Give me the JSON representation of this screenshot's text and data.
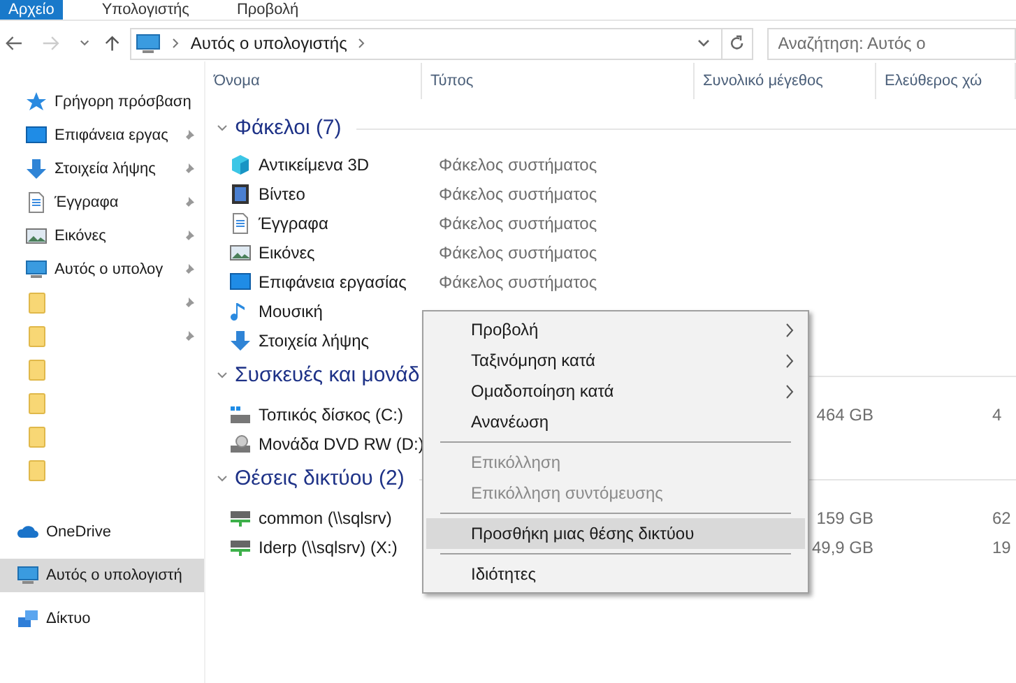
{
  "ribbon_tabs": [
    {
      "label": "Αρχείο",
      "selected": true
    },
    {
      "label": "Υπολογιστής",
      "selected": false
    },
    {
      "label": "Προβολή",
      "selected": false
    }
  ],
  "address_bar": {
    "path": "Αυτός ο υπολογιστής"
  },
  "search": {
    "placeholder": "Αναζήτηση: Αυτός ο"
  },
  "sidebar": {
    "items": [
      {
        "label": "Γρήγορη πρόσβαση",
        "selected": false,
        "pinned": false
      },
      {
        "label": "Επιφάνεια εργας",
        "selected": false,
        "pinned": true
      },
      {
        "label": "Στοιχεία λήψης",
        "selected": false,
        "pinned": true
      },
      {
        "label": "Έγγραφα",
        "selected": false,
        "pinned": true
      },
      {
        "label": "Εικόνες",
        "selected": false,
        "pinned": true
      },
      {
        "label": "Αυτός ο υπολογ",
        "selected": false,
        "pinned": true
      },
      {
        "selected": false,
        "pinned": true
      },
      {
        "selected": false,
        "pinned": true
      },
      {
        "selected": false,
        "pinned": false
      },
      {
        "selected": false,
        "pinned": false
      },
      {
        "selected": false,
        "pinned": false
      },
      {
        "selected": false,
        "pinned": false
      },
      {
        "label": "OneDrive",
        "selected": false,
        "pinned": false
      },
      {
        "label": "Αυτός ο υπολογιστή",
        "selected": true,
        "pinned": false
      },
      {
        "label": "Δίκτυο",
        "selected": false,
        "pinned": false
      }
    ]
  },
  "table": {
    "columns": [
      "Όνομα",
      "Τύπος",
      "Συνολικό μέγεθος",
      "Ελεύθερος χώ"
    ],
    "groups": [
      {
        "title": "Φάκελοι (7)",
        "expanded": true,
        "rows": [
          {
            "name": "Αντικείμενα 3D",
            "type": "Φάκελος συστήματος"
          },
          {
            "name": "Βίντεο",
            "type": "Φάκελος συστήματος"
          },
          {
            "name": "Έγγραφα",
            "type": "Φάκελος συστήματος"
          },
          {
            "name": "Εικόνες",
            "type": "Φάκελος συστήματος"
          },
          {
            "name": "Επιφάνεια εργασίας",
            "type": "Φάκελος συστήματος"
          },
          {
            "name": "Μουσική"
          },
          {
            "name": "Στοιχεία λήψης"
          }
        ]
      },
      {
        "title": "Συσκευές και μονάδ",
        "expanded": true,
        "rows": [
          {
            "name": "Τοπικός δίσκος (C:)",
            "size": "464 GB",
            "free": "4"
          },
          {
            "name": "Μονάδα DVD RW (D:)"
          }
        ]
      },
      {
        "title": "Θέσεις δικτύου (2)",
        "expanded": true,
        "rows": [
          {
            "name": "common (\\\\sqlsrv)",
            "size": "159 GB",
            "free": "62"
          },
          {
            "name": "Iderp (\\\\sqlsrv) (X:)",
            "size": "49,9 GB",
            "free": "19"
          }
        ]
      }
    ]
  },
  "context_menu": {
    "items": [
      {
        "kind": "item",
        "label": "Προβολή",
        "submenu": true,
        "disabled": false,
        "selected": false
      },
      {
        "kind": "item",
        "label": "Ταξινόμηση κατά",
        "submenu": true,
        "disabled": false,
        "selected": false
      },
      {
        "kind": "item",
        "label": "Ομαδοποίηση κατά",
        "submenu": true,
        "disabled": false,
        "selected": false
      },
      {
        "kind": "item",
        "label": "Ανανέωση",
        "submenu": false,
        "disabled": false,
        "selected": false
      },
      {
        "kind": "separator"
      },
      {
        "kind": "item",
        "label": "Επικόλληση",
        "submenu": false,
        "disabled": true,
        "selected": false
      },
      {
        "kind": "item",
        "label": "Επικόλληση συντόμευσης",
        "submenu": false,
        "disabled": true,
        "selected": false
      },
      {
        "kind": "separator"
      },
      {
        "kind": "item",
        "label": "Προσθήκη μιας θέσης δικτύου",
        "submenu": false,
        "disabled": false,
        "selected": true
      },
      {
        "kind": "separator"
      },
      {
        "kind": "item",
        "label": "Ιδιότητες",
        "submenu": false,
        "disabled": false,
        "selected": false
      }
    ]
  }
}
